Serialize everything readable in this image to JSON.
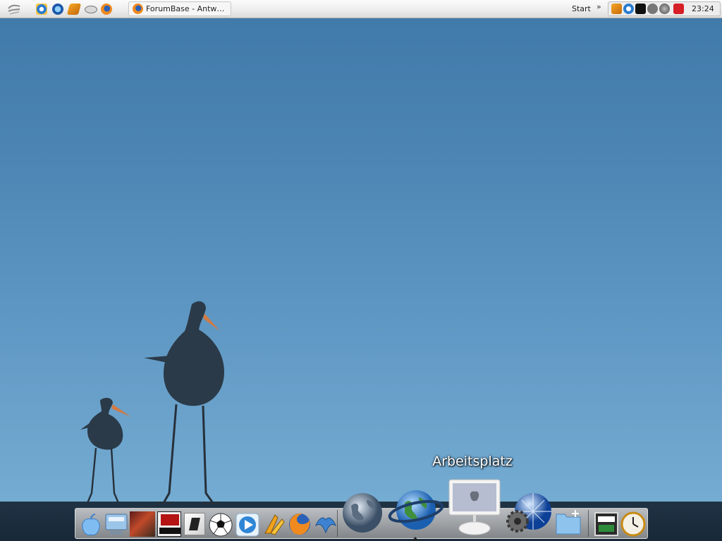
{
  "taskbar": {
    "task_label": "ForumBase - Antw…",
    "start_label": "Start",
    "chevron": "»",
    "clock": "23:24",
    "quicklaunch_icons": [
      "ie-icon",
      "outlook-express-icon",
      "winamp-icon",
      "disk-icon",
      "firefox-icon"
    ],
    "tray_icons": [
      "winamp-tray-icon",
      "check-tray-icon",
      "steam-tray-icon",
      "hardware-tray-icon",
      "speaker-tray-icon",
      "antivirus-tray-icon"
    ]
  },
  "dock": {
    "tooltip": "Arbeitsplatz",
    "items": [
      "finder-icon",
      "my-computer-icon",
      "game-art-icon",
      "mafia-icon",
      "counter-strike-icon",
      "soccer-icon",
      "media-player-icon",
      "winamp-icon",
      "firefox-icon",
      "thunderbird-icon",
      "world-globe-icon",
      "internet-planet-icon",
      "arbeitsplatz-imac-icon",
      "system-preferences-icon",
      "network-globe-icon",
      "new-folder-icon",
      "amd-athlon-icon",
      "clock-icon"
    ]
  },
  "colors": {
    "sky_top": "#3f79a9",
    "sky_bottom": "#7bb1d5",
    "ground": "#1f3344"
  }
}
